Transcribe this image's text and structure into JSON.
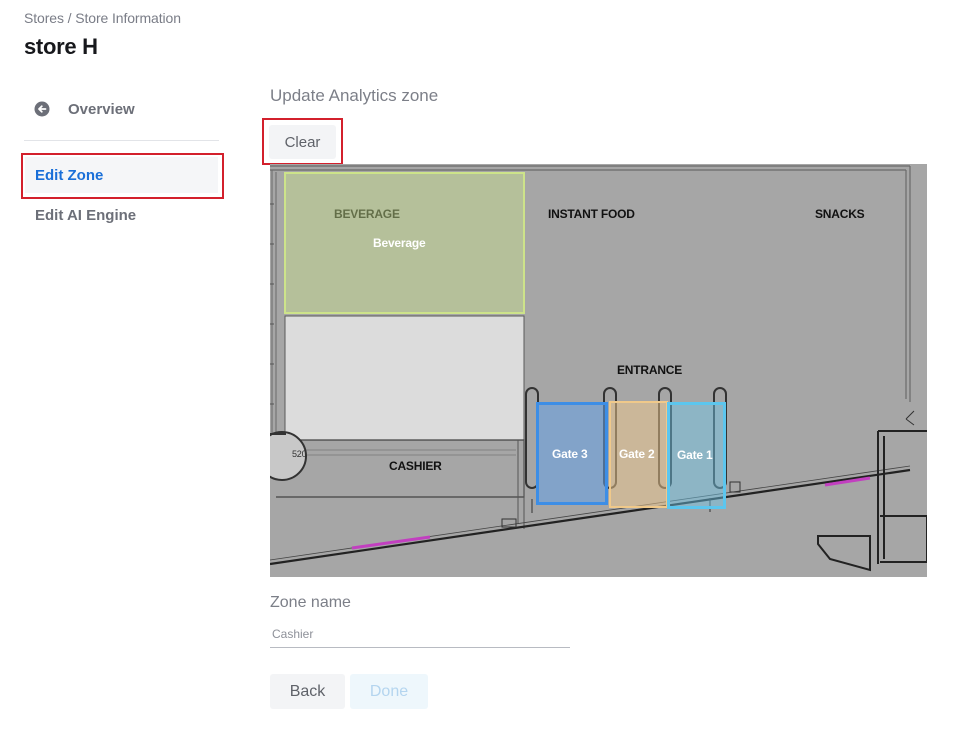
{
  "breadcrumb": "Stores / Store Information",
  "page_title": "store H",
  "sidebar": {
    "overview": {
      "label": "Overview",
      "icon": "arrow-left-circle-icon"
    },
    "items": [
      {
        "label": "Edit Zone",
        "active": true
      },
      {
        "label": "Edit AI Engine",
        "active": false
      }
    ]
  },
  "main": {
    "section_title": "Update Analytics zone",
    "clear_label": "Clear",
    "floorplan": {
      "area_labels": {
        "beverage": "BEVERAGE",
        "instant_food": "INSTANT FOOD",
        "snacks": "SNACKS",
        "entrance": "ENTRANCE",
        "cashier": "CASHIER",
        "dimension": "520"
      },
      "zones": [
        {
          "name": "Beverage",
          "color": "#cde38a"
        },
        {
          "name": "Gate 3",
          "color": "#3d8ee6"
        },
        {
          "name": "Gate 2",
          "color": "#f0c98a"
        },
        {
          "name": "Gate 1",
          "color": "#5cc6ee"
        }
      ]
    },
    "zone_name": {
      "label": "Zone name",
      "value": "Cashier"
    },
    "buttons": {
      "back": "Back",
      "done": "Done"
    }
  },
  "colors": {
    "accent": "#1a6fd8",
    "highlight_box": "#d3202c",
    "floorplan_bg": "#a6a6a6"
  }
}
